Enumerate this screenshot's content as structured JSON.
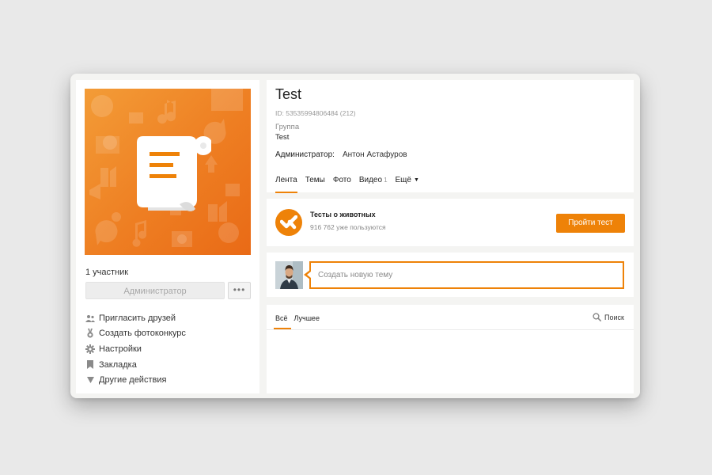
{
  "group": {
    "title": "Test",
    "id_line": "ID: 53535994806484 (212)",
    "type_label": "Группа",
    "type_value": "Test",
    "admin_label": "Администратор:",
    "admin_name": "Антон Астафуров"
  },
  "tabs": [
    {
      "label": "Лента",
      "active": true
    },
    {
      "label": "Темы"
    },
    {
      "label": "Фото"
    },
    {
      "label": "Видео",
      "count": "1"
    },
    {
      "label": "Ещё",
      "icon": "triangle-down-icon"
    }
  ],
  "sidebar": {
    "members": "1 участник",
    "admin_button": "Администратор",
    "more_button": "•••",
    "actions": [
      {
        "label": "Пригласить друзей",
        "icon": "people-icon"
      },
      {
        "label": "Создать фотоконкурс",
        "icon": "medal-icon"
      },
      {
        "label": "Настройки",
        "icon": "gear-icon"
      },
      {
        "label": "Закладка",
        "icon": "bookmark-icon"
      },
      {
        "label": "Другие действия",
        "icon": "triangle-down-icon"
      }
    ]
  },
  "quiz": {
    "title": "Тесты о животных",
    "users": "916 762 уже пользуются",
    "button": "Пройти тест"
  },
  "compose": {
    "placeholder": "Создать новую тему"
  },
  "feed": {
    "tab_all": "Всё",
    "tab_best": "Лучшее",
    "search": "Поиск"
  },
  "colors": {
    "accent": "#ee8208",
    "background": "#e9e9e9"
  }
}
